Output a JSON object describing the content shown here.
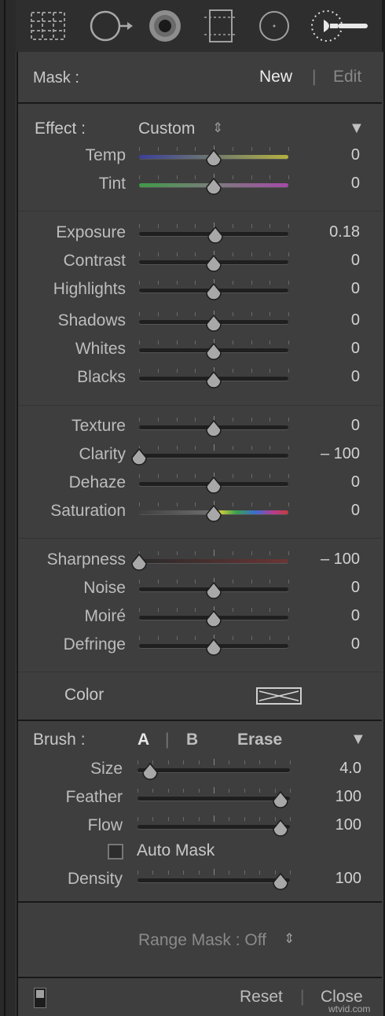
{
  "toolbar": {
    "tools": [
      {
        "icon": "crop-overlay-icon",
        "active": false
      },
      {
        "icon": "spot-removal-icon",
        "active": false
      },
      {
        "icon": "red-eye-icon",
        "active": false
      },
      {
        "icon": "graduated-filter-icon",
        "active": false
      },
      {
        "icon": "radial-filter-icon",
        "active": false
      },
      {
        "icon": "adjustment-brush-icon",
        "active": true
      }
    ]
  },
  "mask": {
    "label": "Mask :",
    "new": "New",
    "separator": "|",
    "edit": "Edit"
  },
  "effect": {
    "label": "Effect :",
    "preset": "Custom",
    "preset_arrows": "⇕",
    "collapse": "▼"
  },
  "sliders": [
    {
      "name": "temp",
      "label": "Temp",
      "value": "0",
      "pos": 0.5,
      "track": "temp"
    },
    {
      "name": "tint",
      "label": "Tint",
      "value": "0",
      "pos": 0.5,
      "track": "tint"
    },
    {
      "name": "exposure",
      "label": "Exposure",
      "value": "0.18",
      "pos": 0.51,
      "track": "plain"
    },
    {
      "name": "contrast",
      "label": "Contrast",
      "value": "0",
      "pos": 0.5,
      "track": "plain"
    },
    {
      "name": "highlights",
      "label": "Highlights",
      "value": "0",
      "pos": 0.5,
      "track": "plain"
    },
    {
      "name": "shadows",
      "label": "Shadows",
      "value": "0",
      "pos": 0.5,
      "track": "plain"
    },
    {
      "name": "whites",
      "label": "Whites",
      "value": "0",
      "pos": 0.5,
      "track": "plain"
    },
    {
      "name": "blacks",
      "label": "Blacks",
      "value": "0",
      "pos": 0.5,
      "track": "plain"
    },
    {
      "name": "texture",
      "label": "Texture",
      "value": "0",
      "pos": 0.5,
      "track": "plain"
    },
    {
      "name": "clarity",
      "label": "Clarity",
      "value": "– 100",
      "pos": 0.0,
      "track": "plain"
    },
    {
      "name": "dehaze",
      "label": "Dehaze",
      "value": "0",
      "pos": 0.5,
      "track": "plain"
    },
    {
      "name": "saturation",
      "label": "Saturation",
      "value": "0",
      "pos": 0.5,
      "track": "saturation"
    },
    {
      "name": "sharpness",
      "label": "Sharpness",
      "value": "– 100",
      "pos": 0.0,
      "track": "sharpness"
    },
    {
      "name": "noise",
      "label": "Noise",
      "value": "0",
      "pos": 0.5,
      "track": "plain"
    },
    {
      "name": "moire",
      "label": "Moiré",
      "value": "0",
      "pos": 0.5,
      "track": "plain"
    },
    {
      "name": "defringe",
      "label": "Defringe",
      "value": "0",
      "pos": 0.5,
      "track": "plain"
    }
  ],
  "color": {
    "label": "Color"
  },
  "brush": {
    "label": "Brush :",
    "a": "A",
    "separator": "|",
    "b": "B",
    "erase": "Erase",
    "collapse": "▼",
    "sliders": [
      {
        "name": "size",
        "label": "Size",
        "value": "4.0",
        "pos": 0.08
      },
      {
        "name": "feather",
        "label": "Feather",
        "value": "100",
        "pos": 0.94
      },
      {
        "name": "flow",
        "label": "Flow",
        "value": "100",
        "pos": 0.94
      },
      {
        "name": "density",
        "label": "Density",
        "value": "100",
        "pos": 0.94
      }
    ],
    "auto_mask": {
      "label": "Auto Mask",
      "checked": false
    }
  },
  "range_mask": {
    "label": "Range Mask : Off",
    "arrows": "⇕"
  },
  "footer": {
    "reset": "Reset",
    "separator": "|",
    "close": "Close"
  },
  "watermark": "wtvid.com"
}
